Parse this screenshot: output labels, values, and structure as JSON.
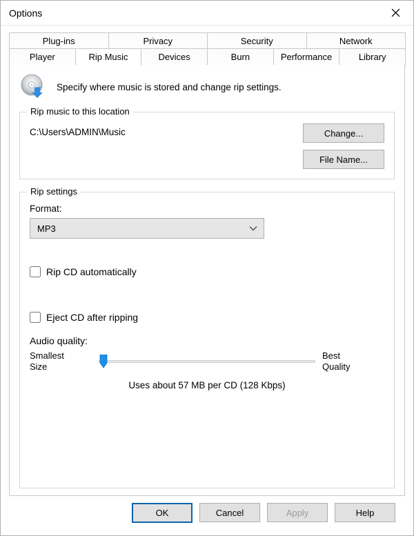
{
  "window": {
    "title": "Options"
  },
  "tabs_row1": [
    {
      "label": "Plug-ins"
    },
    {
      "label": "Privacy"
    },
    {
      "label": "Security"
    },
    {
      "label": "Network"
    }
  ],
  "tabs_row2": [
    {
      "label": "Player"
    },
    {
      "label": "Rip Music",
      "active": true
    },
    {
      "label": "Devices"
    },
    {
      "label": "Burn"
    },
    {
      "label": "Performance"
    },
    {
      "label": "Library"
    }
  ],
  "header": {
    "text": "Specify where music is stored and change rip settings."
  },
  "location_group": {
    "legend": "Rip music to this location",
    "path": "C:\\Users\\ADMIN\\Music",
    "change_label": "Change...",
    "filename_label": "File Name..."
  },
  "settings_group": {
    "legend": "Rip settings",
    "format_label": "Format:",
    "format_value": "MP3",
    "rip_auto_label": "Rip CD automatically",
    "rip_auto_checked": false,
    "eject_label": "Eject CD after ripping",
    "eject_checked": false,
    "quality_label": "Audio quality:",
    "slider_left_a": "Smallest",
    "slider_left_b": "Size",
    "slider_right_a": "Best",
    "slider_right_b": "Quality",
    "usage_text": "Uses about 57 MB per CD (128 Kbps)"
  },
  "buttons": {
    "ok": "OK",
    "cancel": "Cancel",
    "apply": "Apply",
    "help": "Help"
  }
}
